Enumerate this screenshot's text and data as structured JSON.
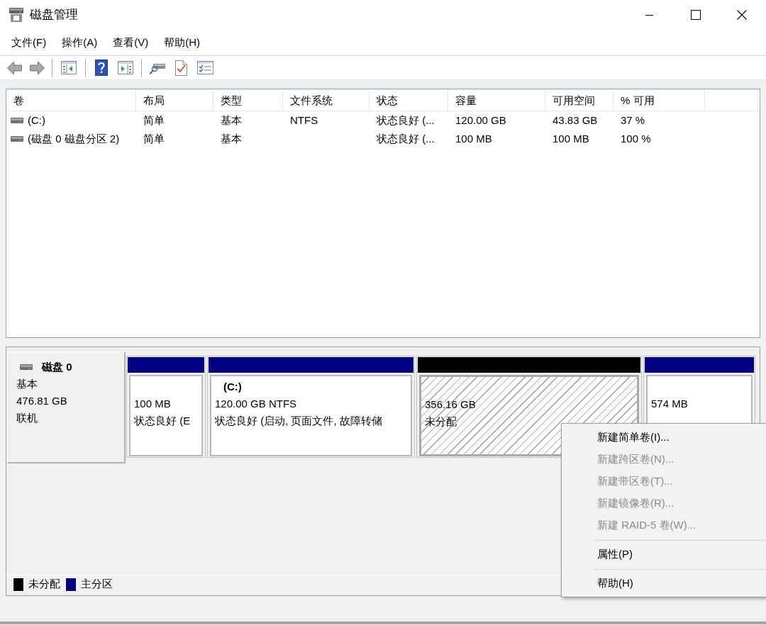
{
  "window": {
    "title": "磁盘管理"
  },
  "menu_bar": [
    {
      "label": "文件(F)"
    },
    {
      "label": "操作(A)"
    },
    {
      "label": "查看(V)"
    },
    {
      "label": "帮助(H)"
    }
  ],
  "volume_table": {
    "columns": [
      "卷",
      "布局",
      "类型",
      "文件系统",
      "状态",
      "容量",
      "可用空间",
      "% 可用"
    ],
    "rows": [
      {
        "volume": "(C:)",
        "layout": "简单",
        "type": "基本",
        "file_system": "NTFS",
        "status": "状态良好 (...",
        "capacity": "120.00 GB",
        "free_space": "43.83 GB",
        "percent_free": "37 %"
      },
      {
        "volume": "(磁盘 0 磁盘分区 2)",
        "layout": "简单",
        "type": "基本",
        "status": "状态良好 (...",
        "capacity": "100 MB",
        "free_space": "100 MB",
        "percent_free": "100 %"
      }
    ]
  },
  "disks": [
    {
      "name": "磁盘 0",
      "type": "基本",
      "size": "476.81 GB",
      "status": "联机",
      "partitions": [
        {
          "kind": "primary",
          "size": "100 MB",
          "status": "状态良好 (E"
        },
        {
          "kind": "primary",
          "label": "(C:)",
          "size": "120.00 GB NTFS",
          "status": "状态良好 (启动, 页面文件, 故障转储"
        },
        {
          "kind": "unallocated",
          "size": "356.16 GB",
          "status": "未分配"
        },
        {
          "kind": "primary",
          "size": "574 MB"
        }
      ]
    }
  ],
  "legend": [
    {
      "label": "未分配",
      "color": "#000000"
    },
    {
      "label": "主分区",
      "color": "#000080"
    }
  ],
  "context_menu": {
    "items": [
      {
        "kind": "item",
        "label": "新建简单卷(I)...",
        "disabled": false
      },
      {
        "kind": "item",
        "label": "新建跨区卷(N)...",
        "disabled": true
      },
      {
        "kind": "item",
        "label": "新建带区卷(T)...",
        "disabled": true
      },
      {
        "kind": "item",
        "label": "新建镜像卷(R)...",
        "disabled": true
      },
      {
        "kind": "item",
        "label": "新建 RAID-5 卷(W)...",
        "disabled": true
      },
      {
        "kind": "separator"
      },
      {
        "kind": "item",
        "label": "属性(P)",
        "disabled": false
      },
      {
        "kind": "separator"
      },
      {
        "kind": "item",
        "label": "帮助(H)",
        "disabled": false
      }
    ]
  }
}
